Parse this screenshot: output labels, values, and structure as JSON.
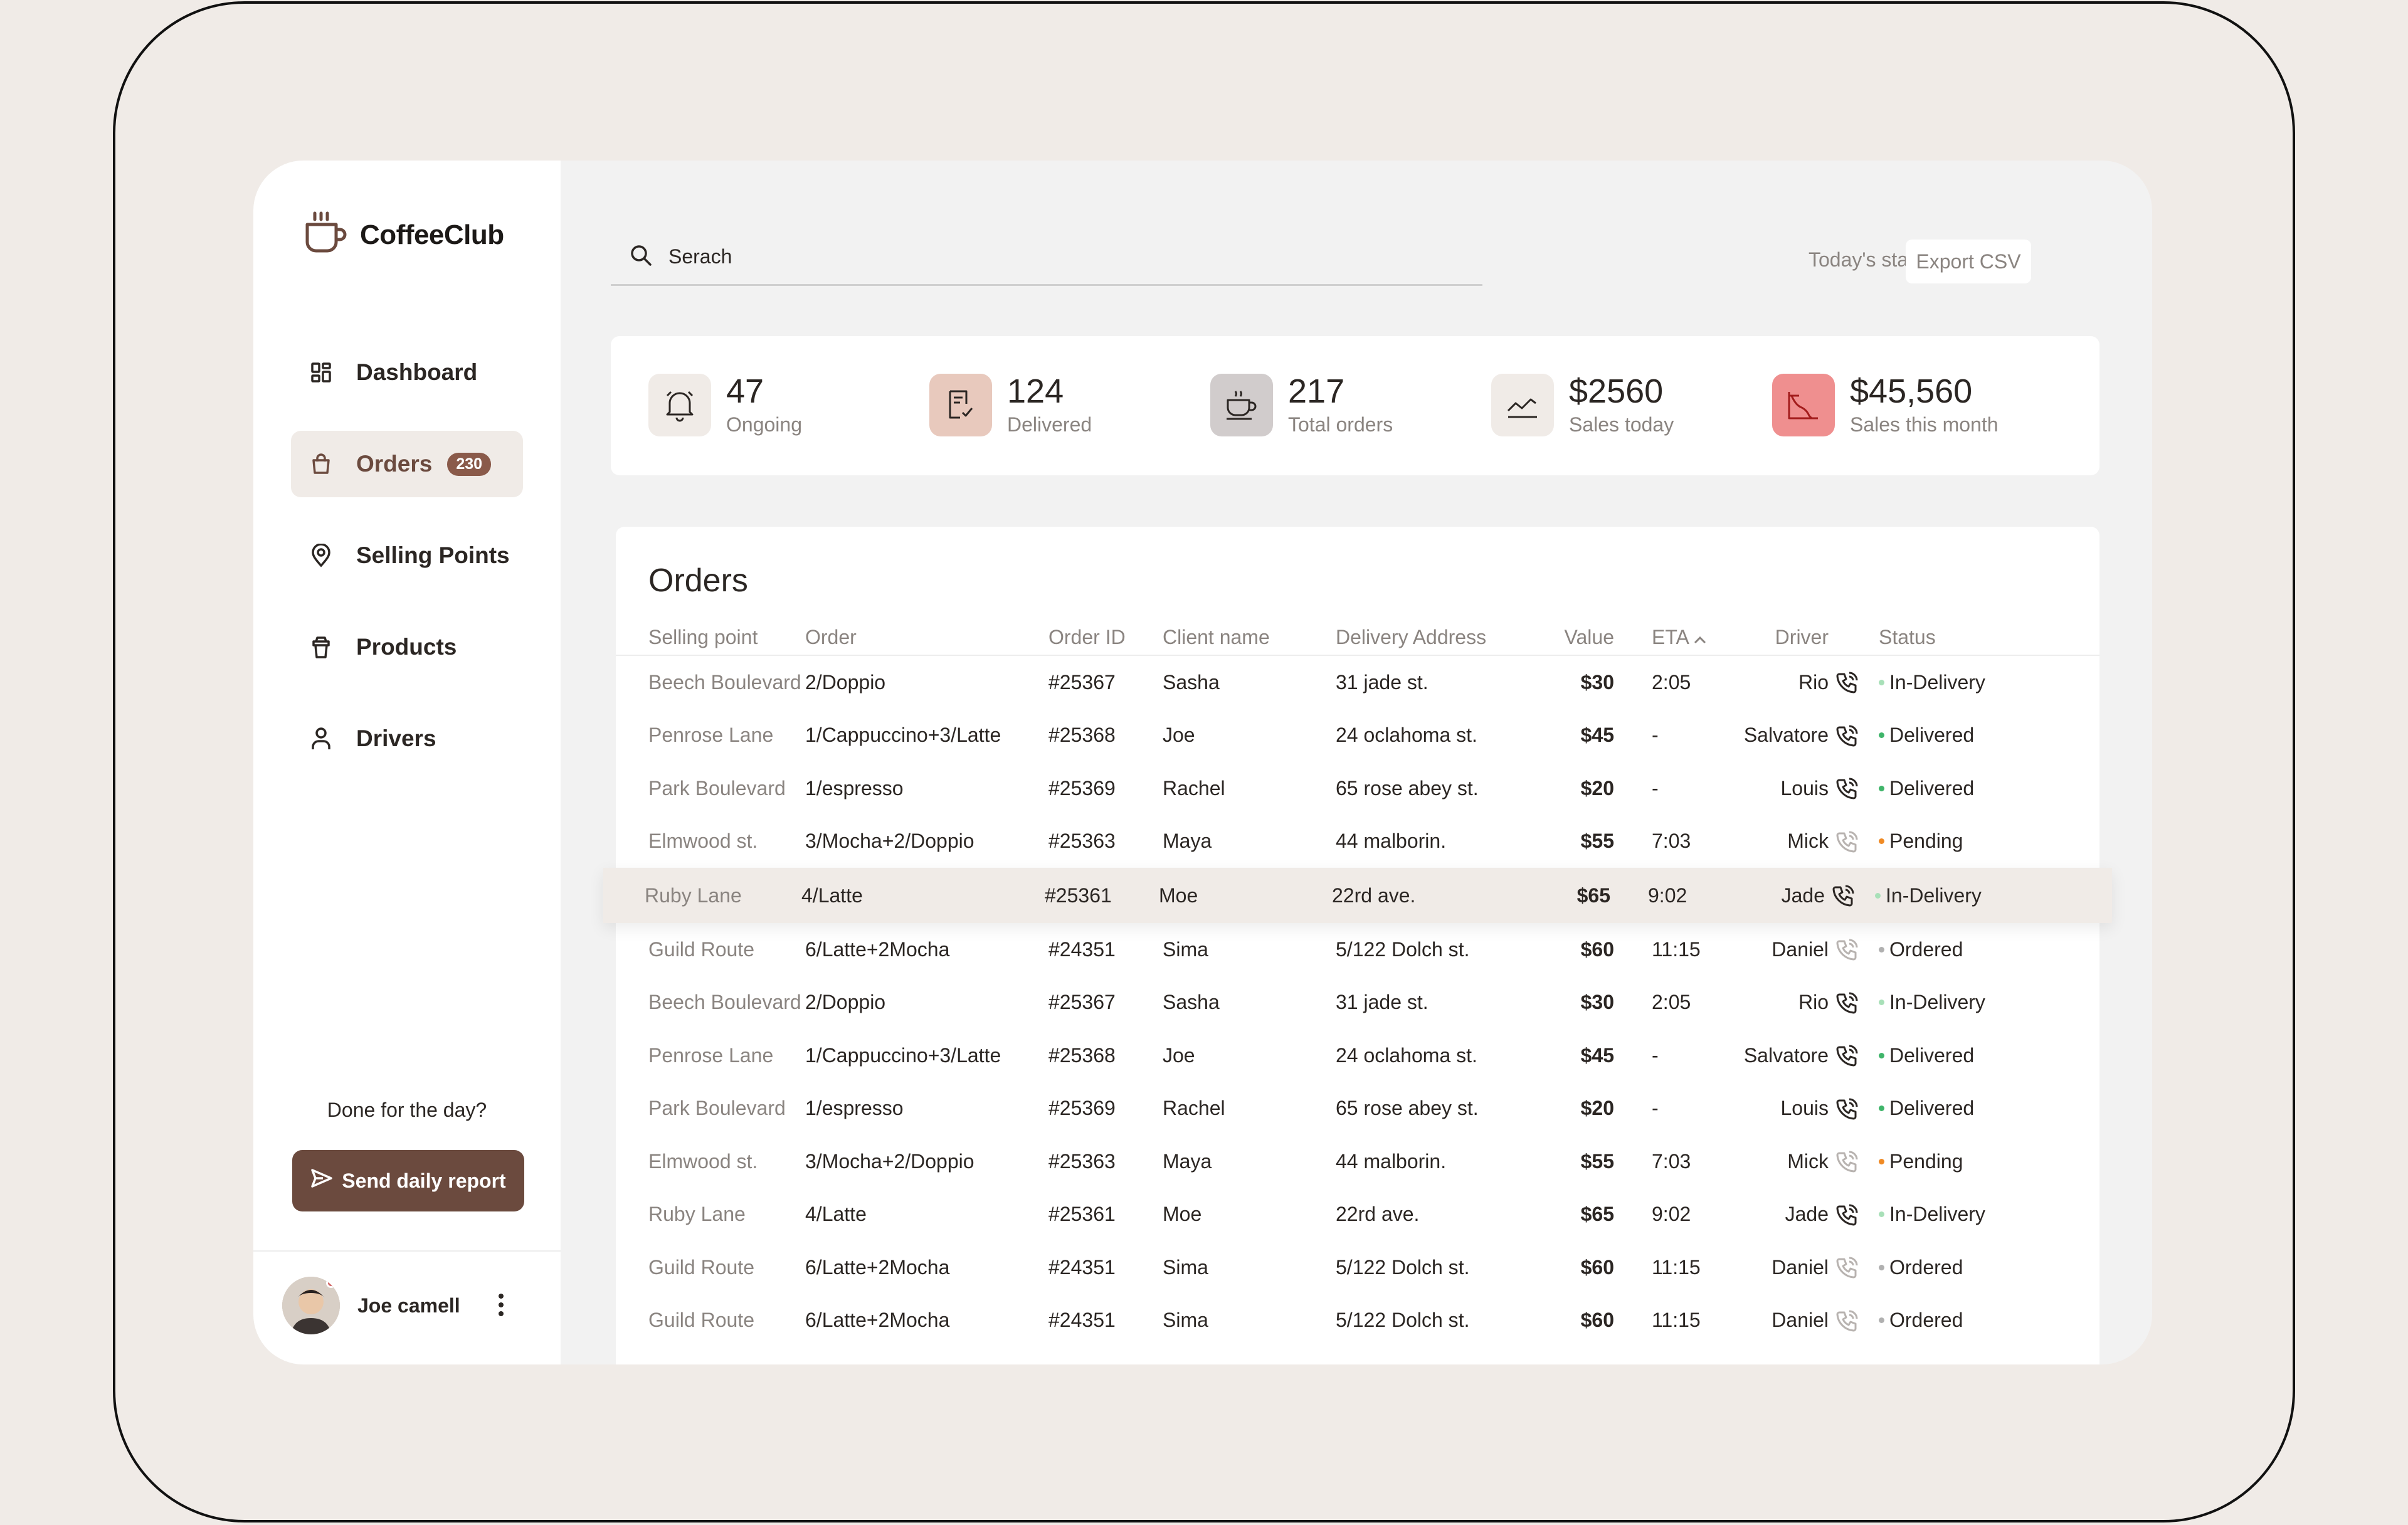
{
  "app": {
    "name": "CoffeeClub"
  },
  "sidebar": {
    "items": [
      {
        "label": "Dashboard",
        "icon": "grid-icon"
      },
      {
        "label": "Orders",
        "icon": "bag-icon",
        "badge": "230",
        "active": true
      },
      {
        "label": "Selling Points",
        "icon": "location-pin-icon"
      },
      {
        "label": "Products",
        "icon": "cup-icon"
      },
      {
        "label": "Drivers",
        "icon": "user-icon"
      }
    ],
    "done_text": "Done for the day?",
    "report_button": "Send daily report",
    "user": {
      "name": "Joe camell"
    }
  },
  "search": {
    "placeholder": "Serach"
  },
  "header": {
    "stats_label": "Today's stats:",
    "export_button": "Export CSV"
  },
  "stats": [
    {
      "value": "47",
      "label": "Ongoing",
      "icon": "bell-icon",
      "color": "#f0ebe7"
    },
    {
      "value": "124",
      "label": "Delivered",
      "icon": "receipt-check-icon",
      "color": "#e8c9bd"
    },
    {
      "value": "217",
      "label": "Total orders",
      "icon": "coffee-cup-icon",
      "color": "#d1cccc"
    },
    {
      "value": "$2560",
      "label": "Sales today",
      "icon": "chart-up-icon",
      "color": "#f0ebe7"
    },
    {
      "value": "$45,560",
      "label": "Sales this month",
      "icon": "chart-down-icon",
      "color": "#ef8f8f"
    }
  ],
  "orders": {
    "title": "Orders",
    "columns": [
      "Selling point",
      "Order",
      "Order ID",
      "Client name",
      "Delivery Address",
      "Value",
      "ETA",
      "Driver",
      "Status"
    ],
    "rows": [
      {
        "sp": "Beech Boulevard",
        "order": "2/Doppio",
        "id": "#25367",
        "client": "Sasha",
        "addr": "31 jade st.",
        "value": "$30",
        "eta": "2:05",
        "driver": "Rio",
        "status": "In-Delivery",
        "phone_active": true
      },
      {
        "sp": "Penrose Lane",
        "order": "1/Cappuccino+3/Latte",
        "id": "#25368",
        "client": "Joe",
        "addr": "24 oclahoma st.",
        "value": "$45",
        "eta": "-",
        "driver": "Salvatore",
        "status": "Delivered",
        "phone_active": true
      },
      {
        "sp": "Park Boulevard",
        "order": "1/espresso",
        "id": "#25369",
        "client": "Rachel",
        "addr": "65 rose abey st.",
        "value": "$20",
        "eta": "-",
        "driver": "Louis",
        "status": "Delivered",
        "phone_active": true
      },
      {
        "sp": "Elmwood st.",
        "order": "3/Mocha+2/Doppio",
        "id": "#25363",
        "client": "Maya",
        "addr": "44 malborin.",
        "value": "$55",
        "eta": "7:03",
        "driver": "Mick",
        "status": "Pending",
        "phone_active": false
      },
      {
        "sp": "Ruby Lane",
        "order": "4/Latte",
        "id": "#25361",
        "client": "Moe",
        "addr": "22rd ave.",
        "value": "$65",
        "eta": "9:02",
        "driver": "Jade",
        "status": "In-Delivery",
        "phone_active": true,
        "highlight": true
      },
      {
        "sp": "Guild Route",
        "order": "6/Latte+2Mocha",
        "id": "#24351",
        "client": "Sima",
        "addr": "5/122 Dolch st.",
        "value": "$60",
        "eta": "11:15",
        "driver": "Daniel",
        "status": "Ordered",
        "phone_active": false
      },
      {
        "sp": "Beech Boulevard",
        "order": "2/Doppio",
        "id": "#25367",
        "client": "Sasha",
        "addr": "31 jade st.",
        "value": "$30",
        "eta": "2:05",
        "driver": "Rio",
        "status": "In-Delivery",
        "phone_active": true
      },
      {
        "sp": "Penrose Lane",
        "order": "1/Cappuccino+3/Latte",
        "id": "#25368",
        "client": "Joe",
        "addr": "24 oclahoma st.",
        "value": "$45",
        "eta": "-",
        "driver": "Salvatore",
        "status": "Delivered",
        "phone_active": true
      },
      {
        "sp": "Park Boulevard",
        "order": "1/espresso",
        "id": "#25369",
        "client": "Rachel",
        "addr": "65 rose abey st.",
        "value": "$20",
        "eta": "-",
        "driver": "Louis",
        "status": "Delivered",
        "phone_active": true
      },
      {
        "sp": "Elmwood st.",
        "order": "3/Mocha+2/Doppio",
        "id": "#25363",
        "client": "Maya",
        "addr": "44 malborin.",
        "value": "$55",
        "eta": "7:03",
        "driver": "Mick",
        "status": "Pending",
        "phone_active": false
      },
      {
        "sp": "Ruby Lane",
        "order": "4/Latte",
        "id": "#25361",
        "client": "Moe",
        "addr": "22rd ave.",
        "value": "$65",
        "eta": "9:02",
        "driver": "Jade",
        "status": "In-Delivery",
        "phone_active": true
      },
      {
        "sp": "Guild Route",
        "order": "6/Latte+2Mocha",
        "id": "#24351",
        "client": "Sima",
        "addr": "5/122 Dolch st.",
        "value": "$60",
        "eta": "11:15",
        "driver": "Daniel",
        "status": "Ordered",
        "phone_active": false
      },
      {
        "sp": "Guild Route",
        "order": "6/Latte+2Mocha",
        "id": "#24351",
        "client": "Sima",
        "addr": "5/122 Dolch st.",
        "value": "$60",
        "eta": "11:15",
        "driver": "Daniel",
        "status": "Ordered",
        "phone_active": false
      }
    ]
  },
  "status_colors": {
    "In-Delivery": "#a8e0b8",
    "Delivered": "#3fb56a",
    "Pending": "#f08a24",
    "Ordered": "#b0b0b0"
  }
}
